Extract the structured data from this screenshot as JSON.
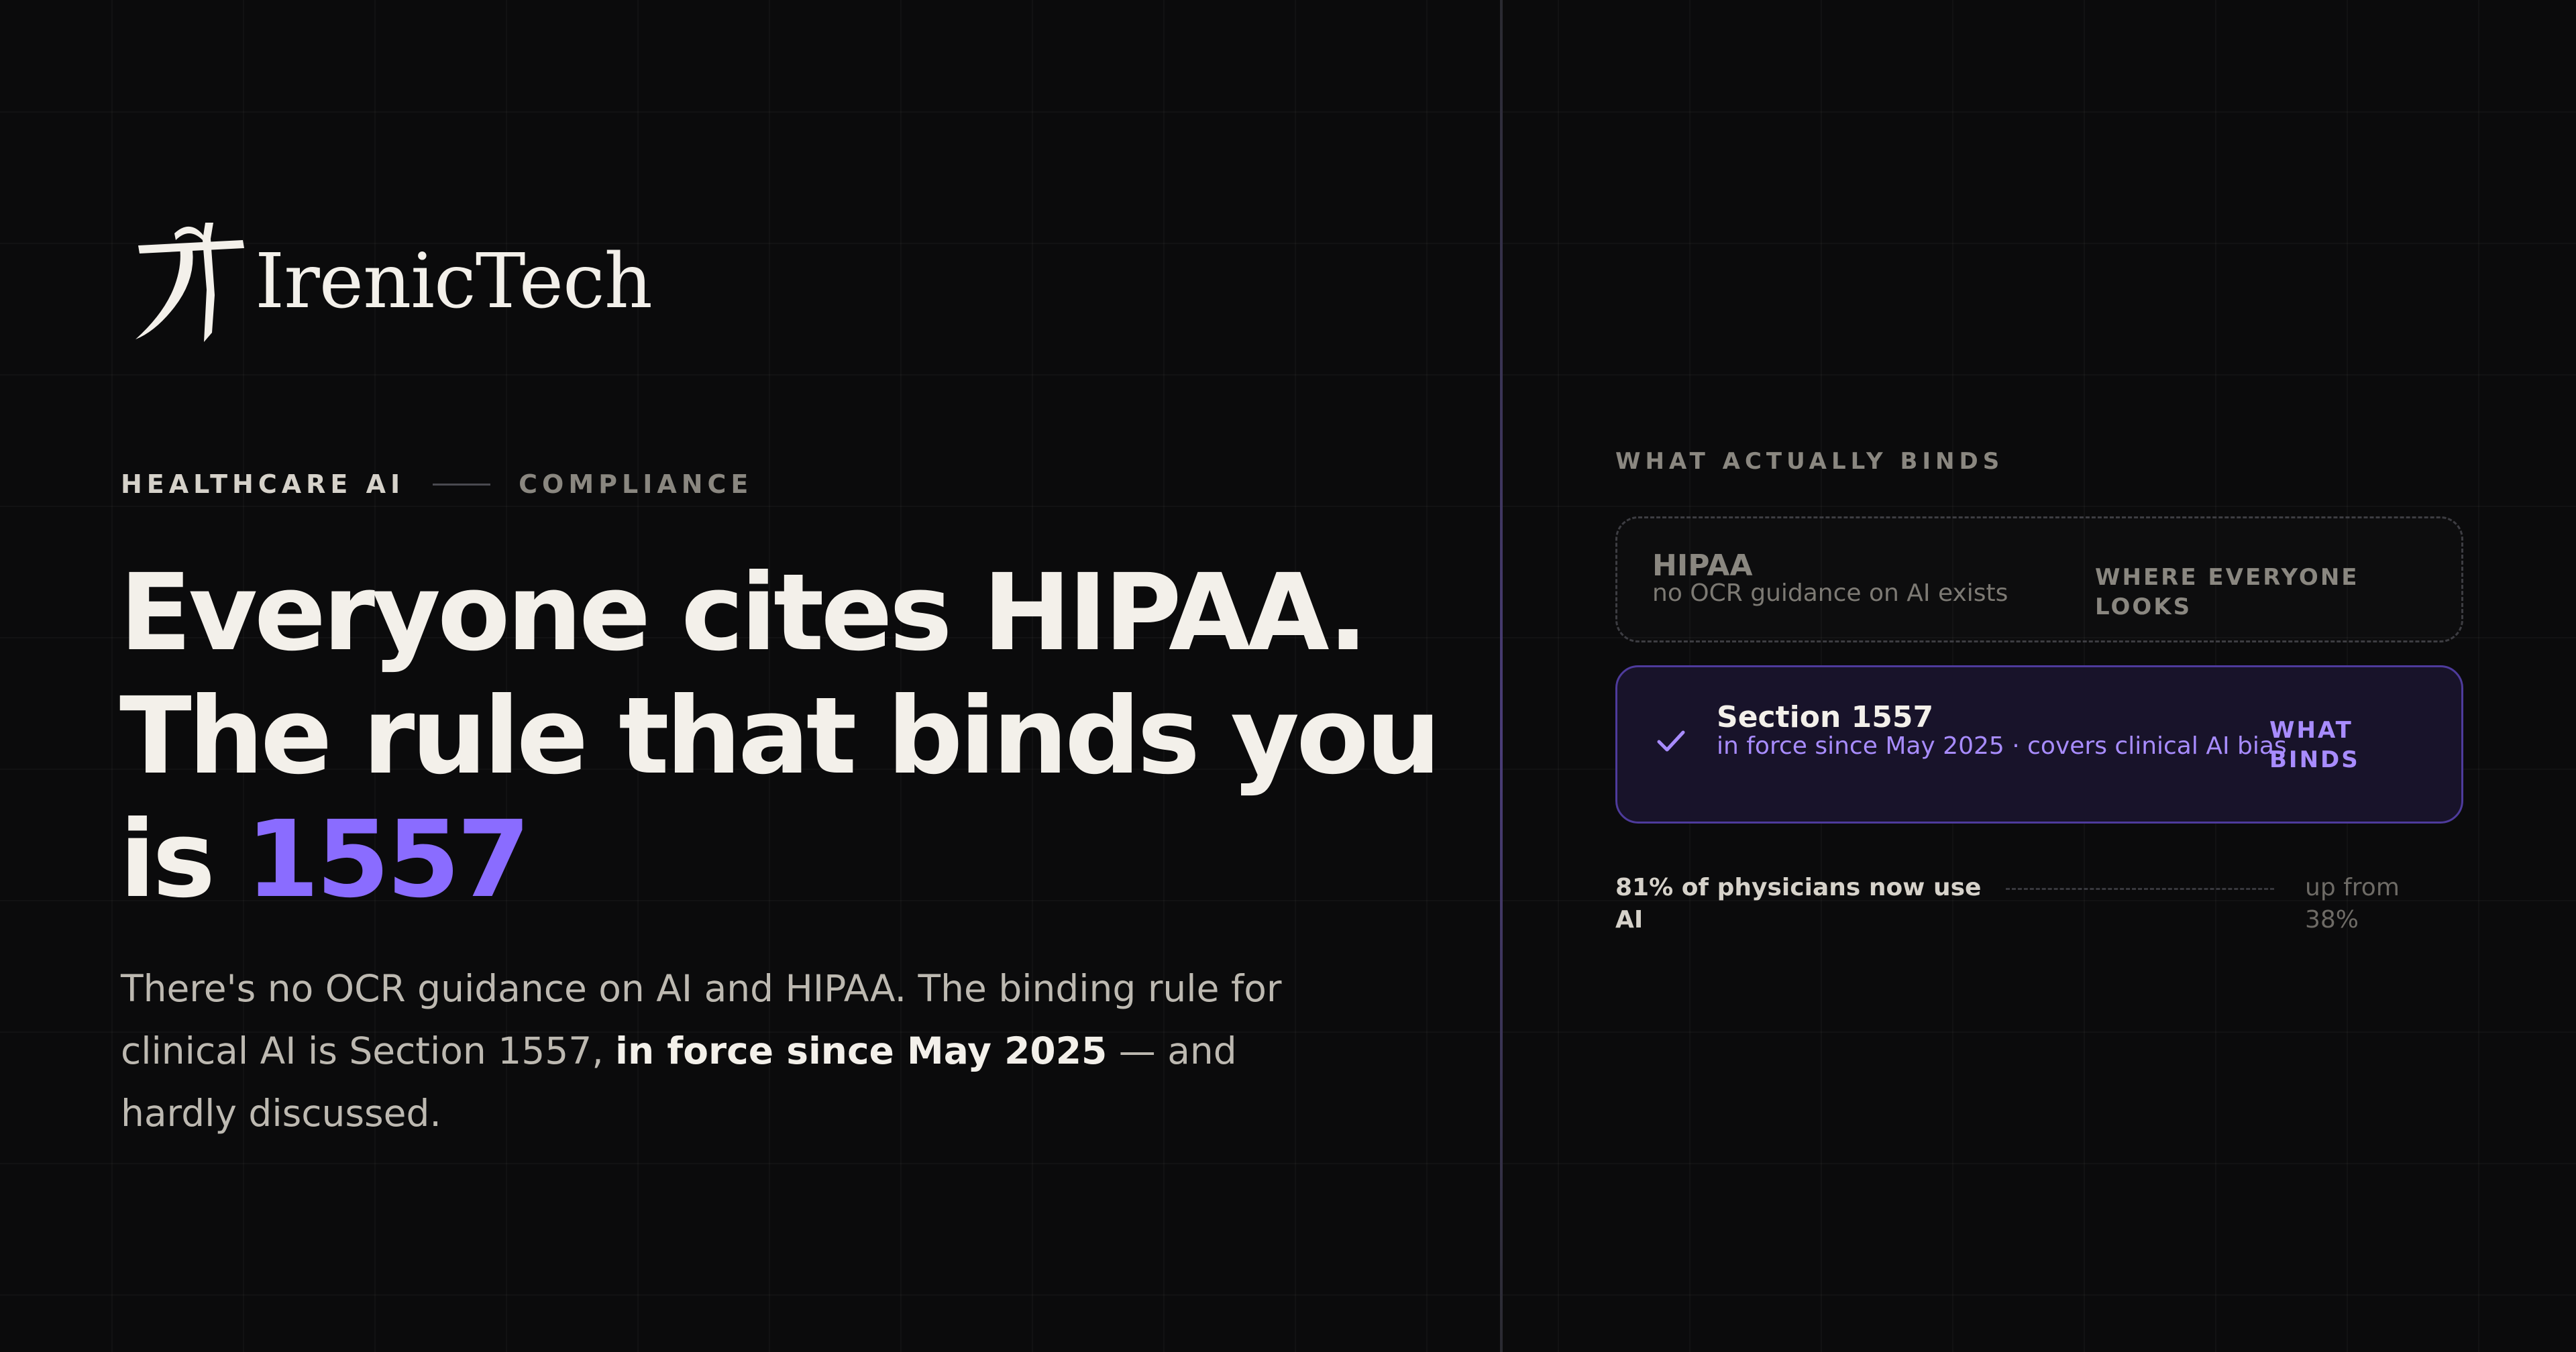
{
  "brand": {
    "name": "IrenicTech"
  },
  "eyebrow": {
    "category": "HEALTHCARE AI",
    "subcategory": "COMPLIANCE"
  },
  "headline": {
    "line_1": "Everyone cites HIPAA.",
    "line_2": "The rule that binds you",
    "line_3_prefix": "is ",
    "line_3_accent": "1557"
  },
  "body": {
    "text_before": "There's no OCR guidance on AI and HIPAA. The binding rule for clinical AI is Section 1557, ",
    "text_bold": "in force since May 2025",
    "text_after": " — and hardly discussed."
  },
  "panel": {
    "label": "WHAT ACTUALLY BINDS",
    "cards": [
      {
        "title": "HIPAA",
        "subtitle": "no OCR guidance on AI exists",
        "tag": "WHERE EVERYONE LOOKS"
      },
      {
        "icon": "check-icon",
        "title": "Section 1557",
        "subtitle": "in force since May 2025 · covers clinical AI bias",
        "tag": "WHAT BINDS"
      }
    ],
    "stat": {
      "main": "81% of physicians now use AI",
      "note": "up from 38%"
    }
  },
  "colors": {
    "background": "#0b0b0c",
    "text": "#f3f0ea",
    "muted": "#8a8780",
    "accent": "#8a6cff",
    "accent_light": "#a88cff",
    "active_card_bg": "#18132a",
    "active_card_border": "#4e3b9c"
  }
}
